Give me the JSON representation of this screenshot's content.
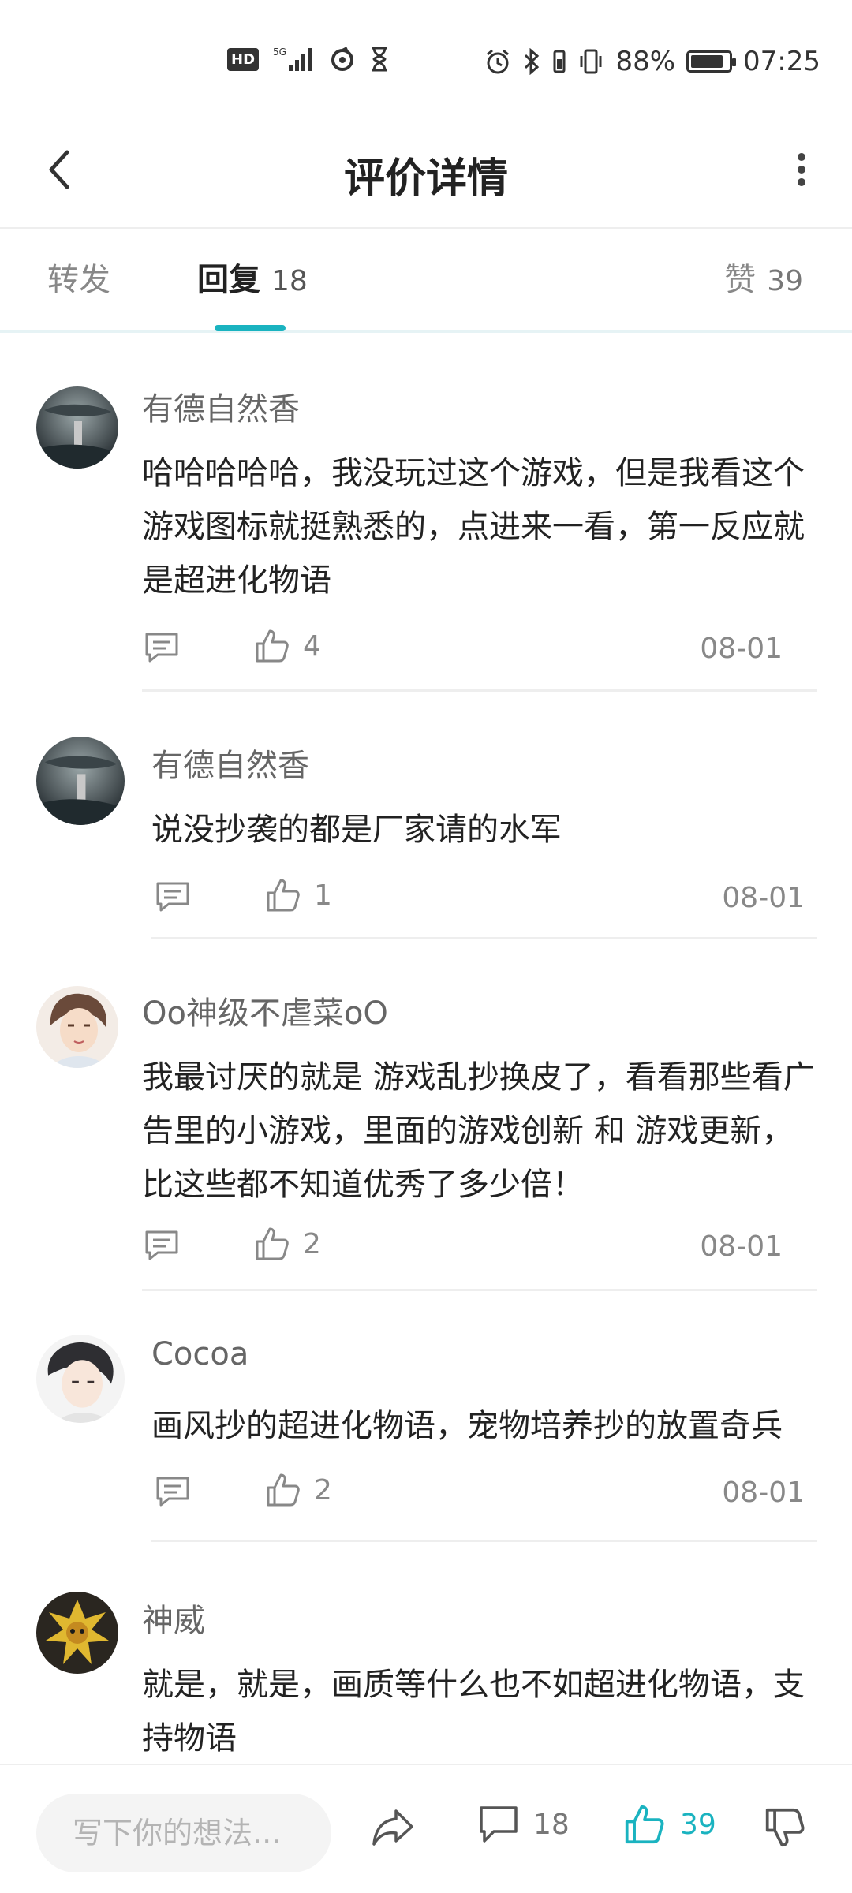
{
  "status_bar": {
    "badge": "HD",
    "network": "5G",
    "battery_percent": "88%",
    "battery_level": 0.88,
    "time": "07:25",
    "icons": [
      "hd-icon",
      "signal-5g-icon",
      "app-icon",
      "hourglass-icon",
      "alarm-icon",
      "bluetooth-icon",
      "vibrate-icon",
      "battery-icon"
    ]
  },
  "header": {
    "title": "评价详情",
    "back_icon": "chevron-left-icon",
    "more_icon": "more-vertical-icon"
  },
  "tabs": {
    "repost_label": "转发",
    "reply_label": "回复",
    "reply_count": "18",
    "like_label": "赞",
    "like_count": "39",
    "active": "回复"
  },
  "comments": [
    {
      "name": "有德自然香",
      "text": "哈哈哈哈哈，我没玩过这个游戏，但是我看这个游戏图标就挺熟悉的，点进来一看，第一反应就是超进化物语",
      "likes": "4",
      "date": "08-01",
      "avatar": "avatar-dark-figure"
    },
    {
      "name": "有德自然香",
      "text": "说没抄袭的都是厂家请的水军",
      "likes": "1",
      "date": "08-01",
      "avatar": "avatar-dark-figure"
    },
    {
      "name": "Oo神级不虐菜oO",
      "text": "我最讨厌的就是 游戏乱抄换皮了，看看那些看广告里的小游戏，里面的游戏创新 和 游戏更新，比这些都不知道优秀了多少倍！",
      "likes": "2",
      "date": "08-01",
      "avatar": "avatar-anime-boy"
    },
    {
      "name": "Cocoa",
      "text": "画风抄的超进化物语，宠物培养抄的放置奇兵",
      "likes": "2",
      "date": "08-01",
      "avatar": "avatar-anime-boy-dark-hair"
    },
    {
      "name": "神威",
      "text": "就是，就是，画质等什么也不如超进化物语，支持物语",
      "avatar": "avatar-golden-creature"
    }
  ],
  "bottom_bar": {
    "input_placeholder": "写下你的想法...",
    "comment_count": "18",
    "like_count": "39",
    "accent_color": "#1ab3c0",
    "icons": [
      "share-icon",
      "comment-icon",
      "thumbs-up-icon",
      "thumbs-down-icon"
    ]
  }
}
